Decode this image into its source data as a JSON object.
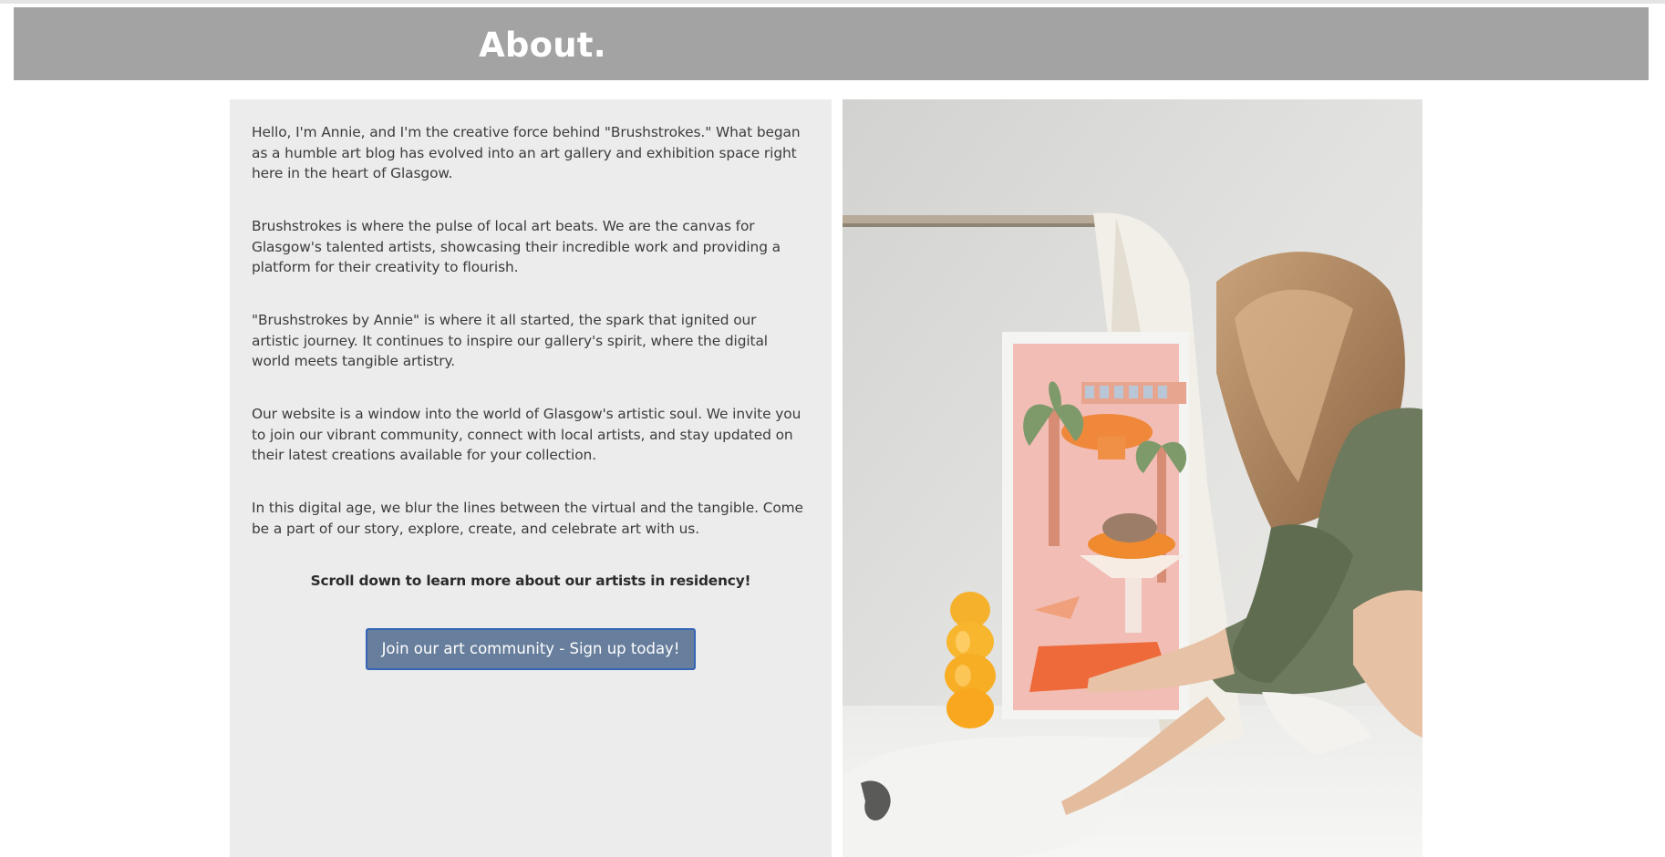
{
  "header": {
    "title": "About."
  },
  "about": {
    "paragraphs": [
      "Hello, I'm Annie, and I'm the creative force behind \"Brushstrokes.\" What began as a humble art blog has evolved into an art gallery and exhibition space right here in the heart of Glasgow.",
      "Brushstrokes is where the pulse of local art beats. We are the canvas for Glasgow's talented artists, showcasing their incredible work and providing a platform for their creativity to flourish.",
      "\"Brushstrokes by Annie\" is where it all started, the spark that ignited our artistic journey. It continues to inspire our gallery's spirit, where the digital world meets tangible artistry.",
      "Our website is a window into the world of Glasgow's artistic soul. We invite you to join our vibrant community, connect with local artists, and stay updated on their latest creations available for your collection.",
      "In this digital age, we blur the lines between the virtual and the tangible. Come be a part of our story, explore, create, and celebrate art with us."
    ],
    "cta": "Scroll down to learn more about our artists in residency!",
    "join_button": "Join our art community - Sign up today!"
  },
  "photo": {
    "alt": "woman-arranging-artwork-photo"
  },
  "colors": {
    "header_bg": "#a3a3a3",
    "panel_bg": "#ececec",
    "button_bg": "#677e9c",
    "button_border": "#3565b5"
  }
}
